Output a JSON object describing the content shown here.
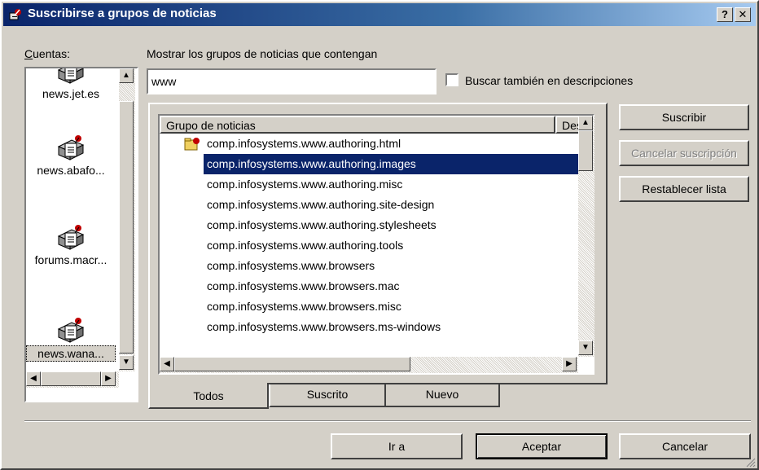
{
  "window": {
    "title": "Suscribirse a grupos de noticias",
    "help_btn": "?",
    "close_btn": "✕"
  },
  "accounts": {
    "label": "Cuentas:",
    "items": [
      {
        "name": "news.jet.es"
      },
      {
        "name": "news.abafo..."
      },
      {
        "name": "forums.macr..."
      },
      {
        "name": "news.wana..."
      }
    ]
  },
  "filter": {
    "label": "Mostrar los grupos de noticias que contengan",
    "value": "www",
    "checkbox_label": "Buscar también en descripciones",
    "checked": false
  },
  "list": {
    "columns": [
      "Grupo de noticias",
      "Desc"
    ],
    "rows": [
      {
        "name": "comp.infosystems.www.authoring.html",
        "subscribed": true
      },
      {
        "name": "comp.infosystems.www.authoring.images",
        "selected": true
      },
      {
        "name": "comp.infosystems.www.authoring.misc"
      },
      {
        "name": "comp.infosystems.www.authoring.site-design"
      },
      {
        "name": "comp.infosystems.www.authoring.stylesheets"
      },
      {
        "name": "comp.infosystems.www.authoring.tools"
      },
      {
        "name": "comp.infosystems.www.browsers"
      },
      {
        "name": "comp.infosystems.www.browsers.mac"
      },
      {
        "name": "comp.infosystems.www.browsers.misc"
      },
      {
        "name": "comp.infosystems.www.browsers.ms-windows"
      }
    ]
  },
  "tabs": [
    "Todos",
    "Suscrito",
    "Nuevo"
  ],
  "side_buttons": {
    "subscribe": "Suscribir",
    "unsubscribe": "Cancelar suscripción",
    "reset": "Restablecer lista"
  },
  "footer_buttons": {
    "goto": "Ir a",
    "ok": "Aceptar",
    "cancel": "Cancelar"
  },
  "colors": {
    "title_gradient_start": "#0a246a",
    "selection": "#0a246a",
    "face": "#d4d0c8"
  }
}
